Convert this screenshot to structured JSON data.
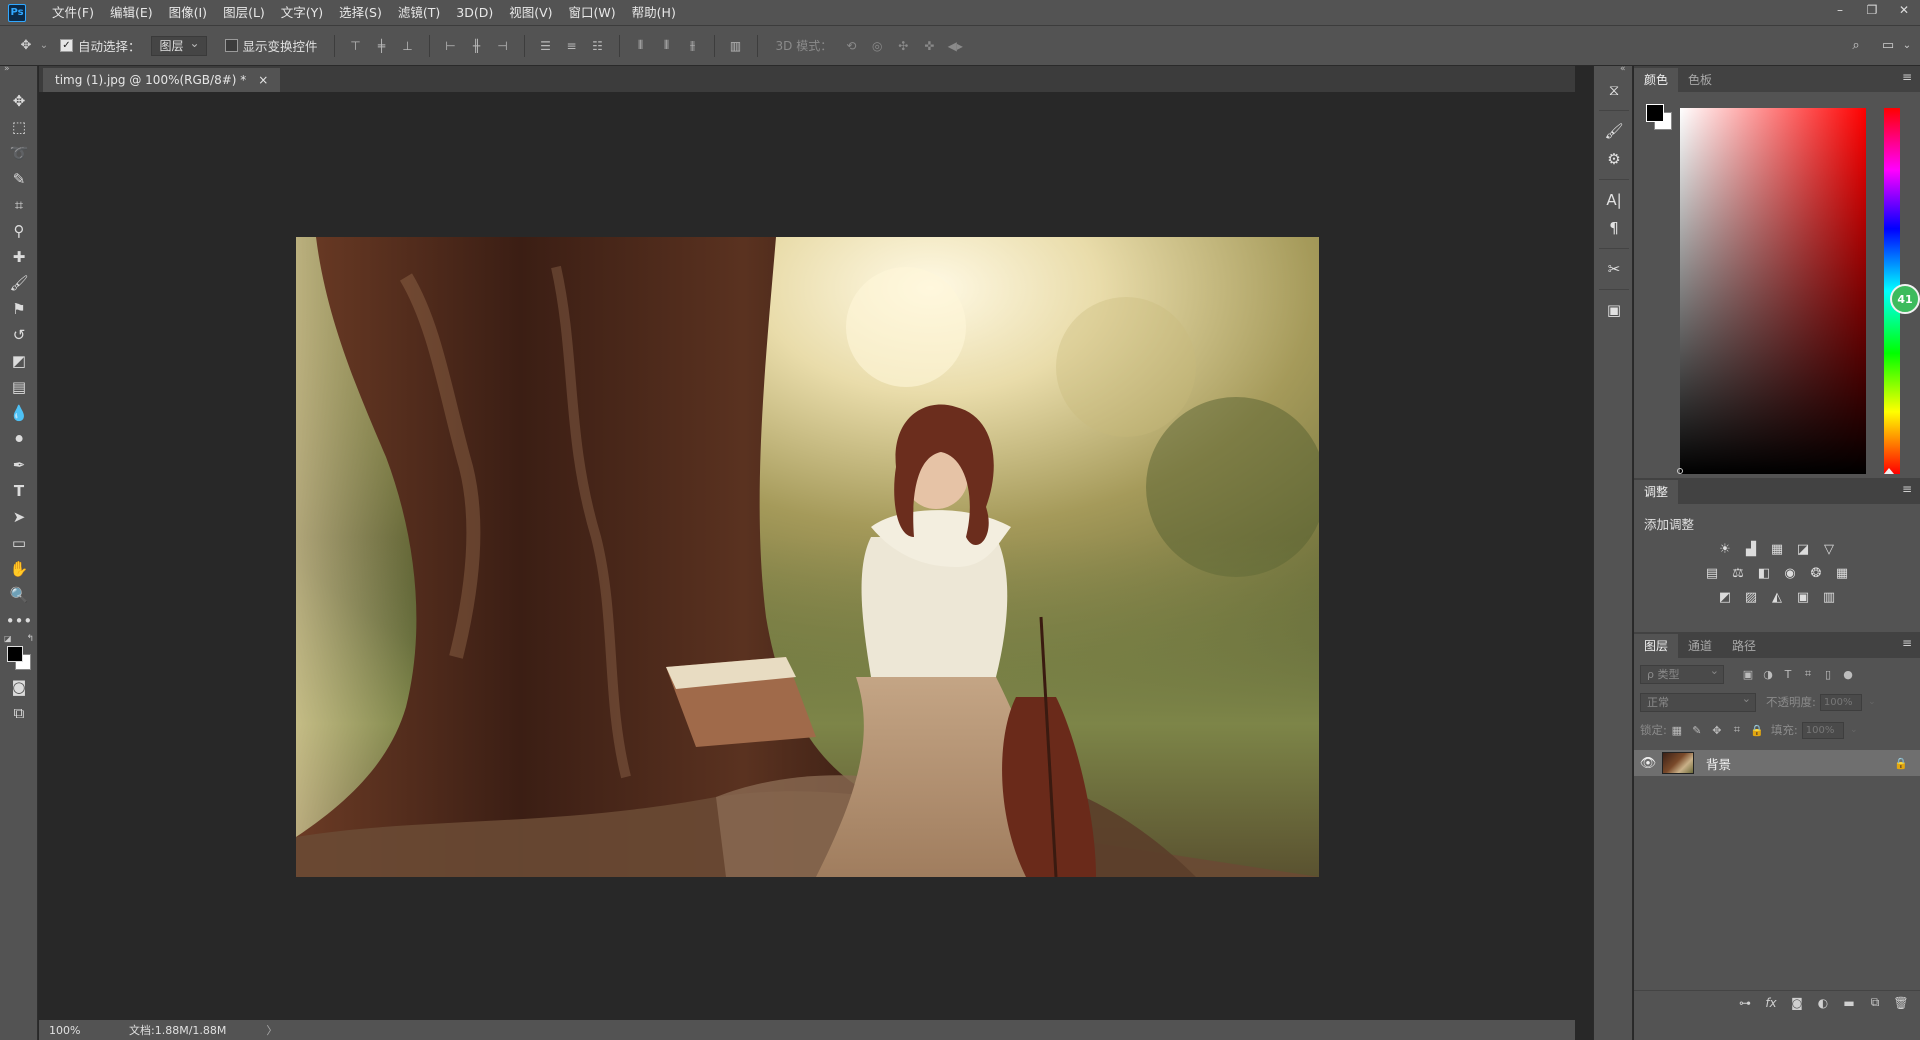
{
  "menubar": {
    "logo": "Ps",
    "items": [
      "文件(F)",
      "编辑(E)",
      "图像(I)",
      "图层(L)",
      "文字(Y)",
      "选择(S)",
      "滤镜(T)",
      "3D(D)",
      "视图(V)",
      "窗口(W)",
      "帮助(H)"
    ],
    "window_controls": [
      "–",
      "❐",
      "✕"
    ]
  },
  "options": {
    "auto_select_label": "自动选择：",
    "auto_select_checked": true,
    "target_value": "图层",
    "show_transform_label": "显示变换控件",
    "mode_3d_label": "3D 模式："
  },
  "document": {
    "tab_title": "timg (1).jpg @ 100%(RGB/8#) *",
    "close": "×"
  },
  "status": {
    "zoom": "100%",
    "doc_size": "文档:1.88M/1.88M",
    "arrow": "〉"
  },
  "panels": {
    "color": {
      "tabs": [
        "颜色",
        "色板"
      ],
      "active": 0,
      "hue_badge": "41"
    },
    "adjustments": {
      "tab": "调整",
      "title": "添加调整"
    },
    "layers": {
      "tabs": [
        "图层",
        "通道",
        "路径"
      ],
      "active": 0,
      "filter_kind": "ρ 类型",
      "blend_mode": "正常",
      "opacity_label": "不透明度:",
      "opacity_value": "100%",
      "lock_label": "锁定:",
      "fill_label": "填充:",
      "fill_value": "100%",
      "layer_name": "背景"
    }
  },
  "colors": {
    "chrome": "#535353",
    "canvas_bg": "#282828",
    "foreground": "#000000",
    "background": "#ffffff",
    "accent": "#31a8ff"
  }
}
